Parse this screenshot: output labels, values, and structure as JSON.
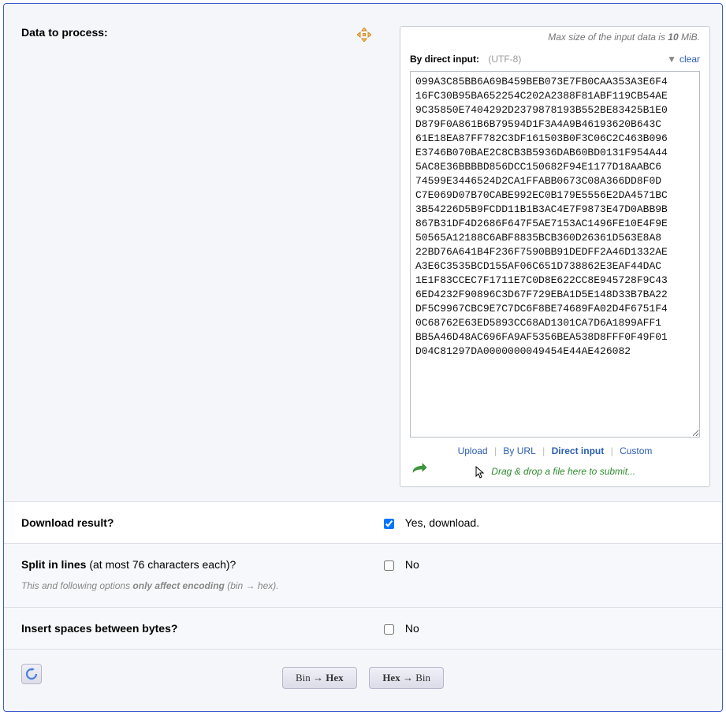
{
  "dataSection": {
    "title": "Data to process:",
    "maxNotePrefix": "Max size of the input data is ",
    "maxNoteBold": "10",
    "maxNoteSuffix": " MiB.",
    "subheader": "By direct input:",
    "encoding": "(UTF-8)",
    "clear": "clear",
    "textarea": "099A3C85BB6A69B459BEB073E7FB0CAA353A3E6F4\n16FC30B95BA652254C202A2388F81ABF119CB54AE\n9C35850E7404292D2379878193B552BE83425B1E0\nD879F0A861B6B79594D1F3A4A9B46193620B643C\n61E18EA87FF782C3DF161503B0F3C06C2C463B096\nE3746B070BAE2C8CB3B5936DAB60BD0131F954A44\n5AC8E36BBBBD856DCC150682F94E1177D18AABC6\n74599E3446524D2CA1FFABB0673C08A366DD8F0D\nC7E069D07B70CABE992EC0B179E5556E2DA4571BC\n3B54226D5B9FCDD11B1B3AC4E7F9873E47D0ABB9B\n867B31DF4D2686F647F5AE7153AC1496FE10E4F9E\n50565A12188C6ABF8835BCB360D26361D563E8A8\n22BD76A641B4F236F7590BB91DEDFF2A46D1332AE\nA3E6C3535BCD155AF06C651D738862E3EAF44DAC\n1E1F83CCEC7F1711E7C0D8E622CC8E945728F9C43\n6ED4232F90896C3D67F729EBA1D5E148D33B7BA22\nDF5C9967CBC9E7C7DC6F8BE74689FA02D4F6751F4\n0C68762E63ED5893CC68AD1301CA7D6A1899AFF1\nBB5A46D48AC696FA9AF5356BEA538D8FFF0F49F01\nD04C81297DA0000000049454E44AE426082",
    "tabs": {
      "upload": "Upload",
      "byUrl": "By URL",
      "direct": "Direct input",
      "custom": "Custom"
    },
    "dragText": "Drag & drop a file here to submit..."
  },
  "download": {
    "title": "Download result?",
    "label": "Yes, download.",
    "checked": true
  },
  "split": {
    "titleBold": "Split in lines",
    "titleRest": " (at most 76 characters each)?",
    "label": "No",
    "checked": false,
    "hintPrefix": "This and following options ",
    "hintBold": "only affect encoding",
    "hintSuffix": " (bin → hex)."
  },
  "spaces": {
    "title": "Insert spaces between bytes?",
    "label": "No",
    "checked": false
  },
  "actions": {
    "binHexA": "Bin",
    "binHexB": "Hex",
    "hexBinA": "Hex",
    "hexBinB": "Bin"
  }
}
